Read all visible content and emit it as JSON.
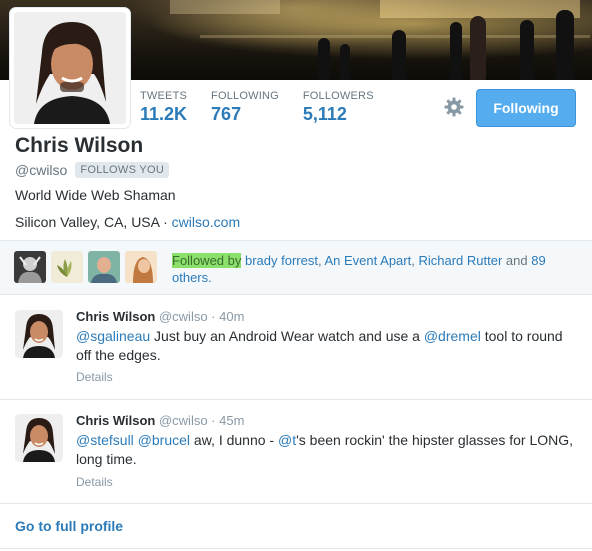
{
  "profile": {
    "name": "Chris Wilson",
    "handle": "@cwilso",
    "follows_you": "FOLLOWS YOU",
    "bio": "World Wide Web Shaman",
    "location": "Silicon Valley, CA, USA",
    "location_sep": " · ",
    "website": "cwilso.com"
  },
  "stats": [
    {
      "label": "TWEETS",
      "value": "11.2K"
    },
    {
      "label": "FOLLOWING",
      "value": "767"
    },
    {
      "label": "FOLLOWERS",
      "value": "5,112"
    }
  ],
  "actions": {
    "following_label": "Following",
    "gear_icon": "gear-icon"
  },
  "followed_by": {
    "prefix": "Followed by",
    "names": [
      "brady forrest",
      "An Event Apart",
      "Richard Rutter"
    ],
    "and_text": "and",
    "others": "89 others."
  },
  "tweets": [
    {
      "name": "Chris Wilson",
      "handle": "@cwilso",
      "time": "40m",
      "mention1": "@sgalineau",
      "text1": " Just buy an Android Wear watch and use a ",
      "mention2": "@dremel",
      "text2": " tool to round off the edges.",
      "details": "Details"
    },
    {
      "name": "Chris Wilson",
      "handle": "@cwilso",
      "time": "45m",
      "mention1": "@stefsull",
      "mention2": "@brucel",
      "text1": " aw, I dunno - ",
      "mention3": "@t",
      "text2": "'s been rockin' the hipster glasses for LONG, long time.",
      "details": "Details"
    }
  ],
  "footer": {
    "full_profile": "Go to full profile"
  },
  "colors": {
    "link": "#2b7bb9",
    "button": "#55acee",
    "highlight": "#8ae06a"
  }
}
